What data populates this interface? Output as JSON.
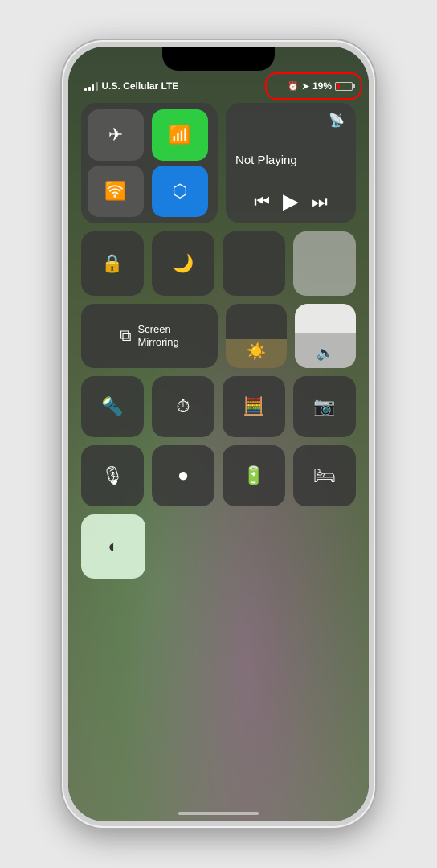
{
  "status_bar": {
    "carrier": "U.S. Cellular LTE",
    "battery_percent": "19%",
    "signal_label": "signal bars"
  },
  "media": {
    "not_playing": "Not Playing",
    "airplay_label": "AirPlay"
  },
  "controls": {
    "screen_mirroring": "Screen\nMirroring",
    "screen_mirroring_label": "Screen Mirroring"
  },
  "battery_indicator": {
    "red_circle": true
  }
}
